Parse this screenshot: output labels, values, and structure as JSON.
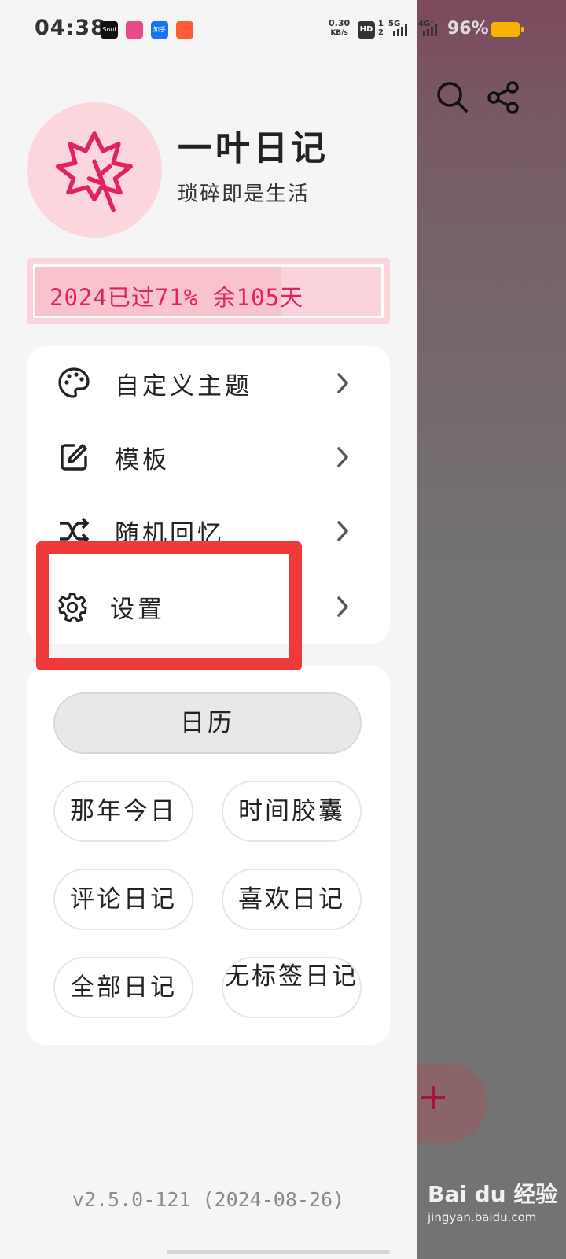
{
  "status_bar": {
    "time": "04:38",
    "apps": [
      "Soul",
      "Lofter",
      "知乎",
      "Kuaishou"
    ],
    "net_speed_value": "0.30",
    "net_speed_unit": "KB/s",
    "hd": "HD",
    "sig1": "5G",
    "sig2": "4G⁺",
    "battery": "96%"
  },
  "app": {
    "name": "一叶日记",
    "tagline": "琐碎即是生活",
    "logo_icon": "maple-leaf-icon"
  },
  "year_progress": {
    "text": "2024已过71% 余105天",
    "percent": 71
  },
  "menu": {
    "items": [
      {
        "label": "自定义主题",
        "icon": "palette-icon"
      },
      {
        "label": "模板",
        "icon": "edit-square-icon"
      },
      {
        "label": "随机回忆",
        "icon": "shuffle-icon"
      },
      {
        "label": "设置",
        "icon": "gear-icon"
      }
    ]
  },
  "nav": {
    "calendar": "日历",
    "chips": [
      "那年今日",
      "时间胶囊",
      "评论日记",
      "喜欢日记",
      "全部日记",
      "无标签日记"
    ]
  },
  "version": "v2.5.0-121 (2024-08-26)",
  "watermark": {
    "title": "Bai du 经验",
    "url": "jingyan.baidu.com"
  },
  "colors": {
    "accent": "#e0245e",
    "highlight": "#f03a3a",
    "progress_bg": "#fbd3da"
  }
}
